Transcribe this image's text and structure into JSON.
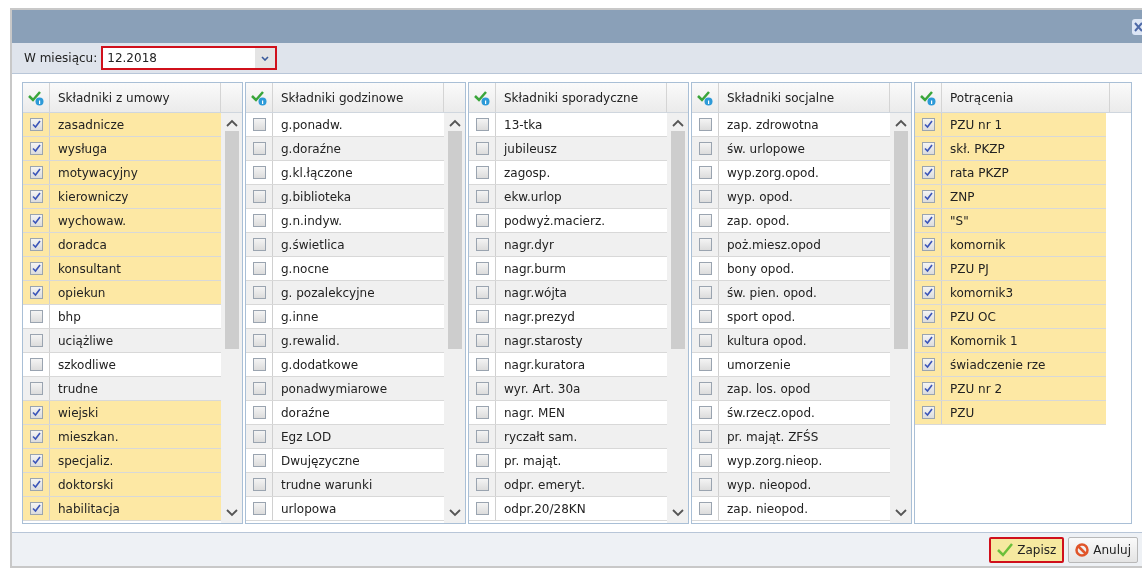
{
  "month_filter": {
    "label": "W miesiącu:",
    "value": "12.2018",
    "highlighted": true
  },
  "columns": [
    {
      "title": "Składniki z umowy",
      "scrollable": true,
      "items": [
        {
          "label": "zasadnicze",
          "checked": true
        },
        {
          "label": "wysługa",
          "checked": true
        },
        {
          "label": "motywacyjny",
          "checked": true
        },
        {
          "label": "kierowniczy",
          "checked": true
        },
        {
          "label": "wychowaw.",
          "checked": true
        },
        {
          "label": "doradca",
          "checked": true
        },
        {
          "label": "konsultant",
          "checked": true
        },
        {
          "label": "opiekun",
          "checked": true
        },
        {
          "label": "bhp",
          "checked": false
        },
        {
          "label": "uciążliwe",
          "checked": false
        },
        {
          "label": "szkodliwe",
          "checked": false
        },
        {
          "label": "trudne",
          "checked": false
        },
        {
          "label": "wiejski",
          "checked": true
        },
        {
          "label": "mieszkan.",
          "checked": true
        },
        {
          "label": "specjaliz.",
          "checked": true
        },
        {
          "label": "doktorski",
          "checked": true
        },
        {
          "label": "habilitacja",
          "checked": true
        }
      ]
    },
    {
      "title": "Składniki godzinowe",
      "scrollable": true,
      "items": [
        {
          "label": "g.ponadw.",
          "checked": false
        },
        {
          "label": "g.doraźne",
          "checked": false
        },
        {
          "label": "g.kl.łączone",
          "checked": false
        },
        {
          "label": "g.biblioteka",
          "checked": false
        },
        {
          "label": "g.n.indyw.",
          "checked": false
        },
        {
          "label": "g.świetlica",
          "checked": false
        },
        {
          "label": "g.nocne",
          "checked": false
        },
        {
          "label": "g. pozalekcyjne",
          "checked": false
        },
        {
          "label": "g.inne",
          "checked": false
        },
        {
          "label": "g.rewalid.",
          "checked": false
        },
        {
          "label": "g.dodatkowe",
          "checked": false
        },
        {
          "label": "ponadwymiarowe",
          "checked": false
        },
        {
          "label": "doraźne",
          "checked": false
        },
        {
          "label": "Egz LOD",
          "checked": false
        },
        {
          "label": "Dwujęzyczne",
          "checked": false
        },
        {
          "label": "trudne warunki",
          "checked": false
        },
        {
          "label": "urlopowa",
          "checked": false
        }
      ]
    },
    {
      "title": "Składniki sporadyczne",
      "scrollable": true,
      "items": [
        {
          "label": "13-tka",
          "checked": false
        },
        {
          "label": "jubileusz",
          "checked": false
        },
        {
          "label": "zagosp.",
          "checked": false
        },
        {
          "label": "ekw.urlop",
          "checked": false
        },
        {
          "label": "podwyż.macierz.",
          "checked": false
        },
        {
          "label": "nagr.dyr",
          "checked": false
        },
        {
          "label": "nagr.burm",
          "checked": false
        },
        {
          "label": "nagr.wójta",
          "checked": false
        },
        {
          "label": "nagr.prezyd",
          "checked": false
        },
        {
          "label": "nagr.starosty",
          "checked": false
        },
        {
          "label": "nagr.kuratora",
          "checked": false
        },
        {
          "label": "wyr. Art. 30a",
          "checked": false
        },
        {
          "label": "nagr. MEN",
          "checked": false
        },
        {
          "label": "ryczałt sam.",
          "checked": false
        },
        {
          "label": "pr. mająt.",
          "checked": false
        },
        {
          "label": "odpr. emeryt.",
          "checked": false
        },
        {
          "label": "odpr.20/28KN",
          "checked": false
        }
      ]
    },
    {
      "title": "Składniki socjalne",
      "scrollable": true,
      "items": [
        {
          "label": "zap. zdrowotna",
          "checked": false
        },
        {
          "label": "św. urlopowe",
          "checked": false
        },
        {
          "label": "wyp.zorg.opod.",
          "checked": false
        },
        {
          "label": "wyp. opod.",
          "checked": false
        },
        {
          "label": "zap. opod.",
          "checked": false
        },
        {
          "label": "poż.miesz.opod",
          "checked": false
        },
        {
          "label": "bony opod.",
          "checked": false
        },
        {
          "label": "św. pien. opod.",
          "checked": false
        },
        {
          "label": "sport opod.",
          "checked": false
        },
        {
          "label": "kultura opod.",
          "checked": false
        },
        {
          "label": "umorzenie",
          "checked": false
        },
        {
          "label": "zap. los. opod",
          "checked": false
        },
        {
          "label": "św.rzecz.opod.",
          "checked": false
        },
        {
          "label": "pr. mająt. ZFŚS",
          "checked": false
        },
        {
          "label": "wyp.zorg.nieop.",
          "checked": false
        },
        {
          "label": "wyp. nieopod.",
          "checked": false
        },
        {
          "label": "zap. nieopod.",
          "checked": false
        }
      ]
    },
    {
      "title": "Potrącenia",
      "scrollable": false,
      "items": [
        {
          "label": "PZU nr 1",
          "checked": true
        },
        {
          "label": "skł. PKZP",
          "checked": true
        },
        {
          "label": "rata PKZP",
          "checked": true
        },
        {
          "label": "ZNP",
          "checked": true
        },
        {
          "label": "\"S\"",
          "checked": true
        },
        {
          "label": "komornik",
          "checked": true
        },
        {
          "label": "PZU PJ",
          "checked": true
        },
        {
          "label": "komornik3",
          "checked": true
        },
        {
          "label": "PZU OC",
          "checked": true
        },
        {
          "label": "Komornik 1",
          "checked": true
        },
        {
          "label": "świadczenie rze",
          "checked": true
        },
        {
          "label": "PZU nr 2",
          "checked": true
        },
        {
          "label": "PZU",
          "checked": true
        }
      ]
    }
  ],
  "buttons": [
    {
      "label": "Zapisz",
      "kind": "save",
      "highlighted": true
    },
    {
      "label": "Anuluj",
      "kind": "cancel",
      "highlighted": false
    }
  ]
}
